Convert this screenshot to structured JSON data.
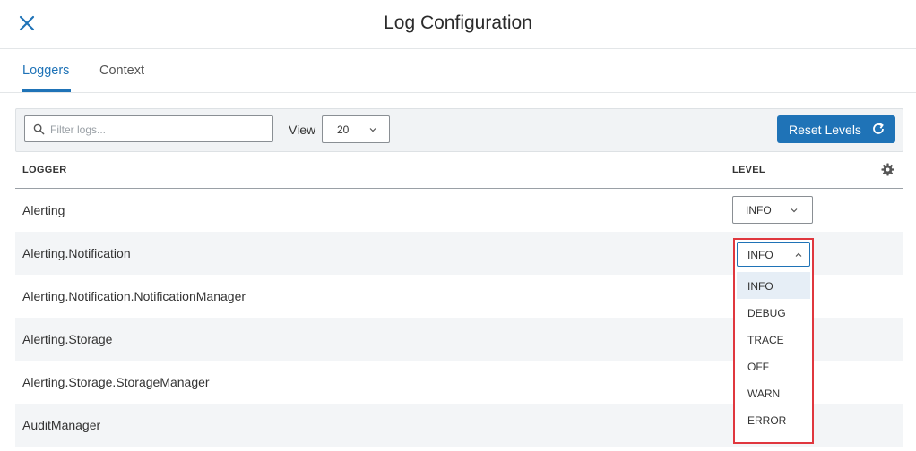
{
  "header": {
    "title": "Log Configuration",
    "close_icon": "close-icon",
    "accent_color": "#1f73b7"
  },
  "tabs": [
    {
      "label": "Loggers",
      "active": true
    },
    {
      "label": "Context",
      "active": false
    }
  ],
  "toolbar": {
    "search_placeholder": "Filter logs...",
    "search_value": "",
    "view_label": "View",
    "view_value": "20",
    "reset_label": "Reset Levels",
    "reset_icon": "refresh-icon"
  },
  "table": {
    "columns": [
      "LOGGER",
      "LEVEL"
    ],
    "settings_icon": "gear-icon",
    "rows": [
      {
        "name": "Alerting",
        "level": "INFO"
      },
      {
        "name": "Alerting.Notification",
        "level": "INFO"
      },
      {
        "name": "Alerting.Notification.NotificationManager",
        "level": ""
      },
      {
        "name": "Alerting.Storage",
        "level": ""
      },
      {
        "name": "Alerting.Storage.StorageManager",
        "level": ""
      },
      {
        "name": "AuditManager",
        "level": ""
      }
    ]
  },
  "dropdown": {
    "value": "INFO",
    "options": [
      "INFO",
      "DEBUG",
      "TRACE",
      "OFF",
      "WARN",
      "ERROR"
    ],
    "selected_index": 0,
    "highlight_color": "#e0373e"
  }
}
